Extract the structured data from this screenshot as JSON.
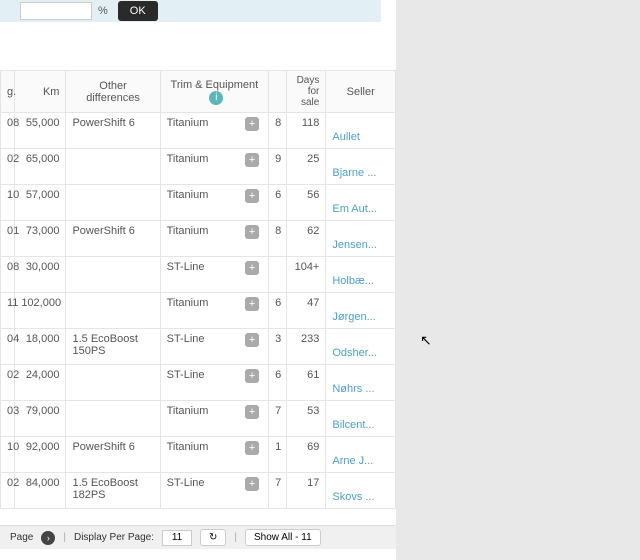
{
  "topbar": {
    "pct_label": "%",
    "ok_label": "OK"
  },
  "headers": {
    "reg": "g.",
    "km": "Km",
    "other": "Other differences",
    "trim": "Trim & Equipment",
    "num": "",
    "days": "Days for sale",
    "seller": "Seller"
  },
  "rows": [
    {
      "reg": "08",
      "km": "55,000",
      "other": "PowerShift 6",
      "trim": "Titanium",
      "num": "8",
      "days": "118",
      "seller": "Aullet"
    },
    {
      "reg": "02",
      "km": "65,000",
      "other": "",
      "trim": "Titanium",
      "num": "9",
      "days": "25",
      "seller": "Bjarne ..."
    },
    {
      "reg": "10",
      "km": "57,000",
      "other": "",
      "trim": "Titanium",
      "num": "6",
      "days": "56",
      "seller": "Em Aut..."
    },
    {
      "reg": "01",
      "km": "73,000",
      "other": "PowerShift 6",
      "trim": "Titanium",
      "num": "8",
      "days": "62",
      "seller": "Jensen..."
    },
    {
      "reg": "08",
      "km": "30,000",
      "other": "",
      "trim": "ST-Line",
      "num": "",
      "days": "104+",
      "seller": "Holbæ..."
    },
    {
      "reg": "11",
      "km": "102,000",
      "other": "",
      "trim": "Titanium",
      "num": "6",
      "days": "47",
      "seller": "Jørgen..."
    },
    {
      "reg": "04",
      "km": "18,000",
      "other": "1.5 EcoBoost 150PS",
      "trim": "ST-Line",
      "num": "3",
      "days": "233",
      "seller": "Odsher..."
    },
    {
      "reg": "02",
      "km": "24,000",
      "other": "",
      "trim": "ST-Line",
      "num": "6",
      "days": "61",
      "seller": "Nøhrs ..."
    },
    {
      "reg": "03",
      "km": "79,000",
      "other": "",
      "trim": "Titanium",
      "num": "7",
      "days": "53",
      "seller": "Bilcent..."
    },
    {
      "reg": "10",
      "km": "92,000",
      "other": "PowerShift 6",
      "trim": "Titanium",
      "num": "1",
      "days": "69",
      "seller": "Arne J..."
    },
    {
      "reg": "02",
      "km": "84,000",
      "other": "1.5 EcoBoost 182PS",
      "trim": "ST-Line",
      "num": "7",
      "days": "17",
      "seller": "Skovs ..."
    }
  ],
  "pager": {
    "page_label": "Page",
    "display_label": "Display Per Page:",
    "page_value": "11",
    "refresh": "↻",
    "sep": "|",
    "show_all": "Show All - 11"
  }
}
